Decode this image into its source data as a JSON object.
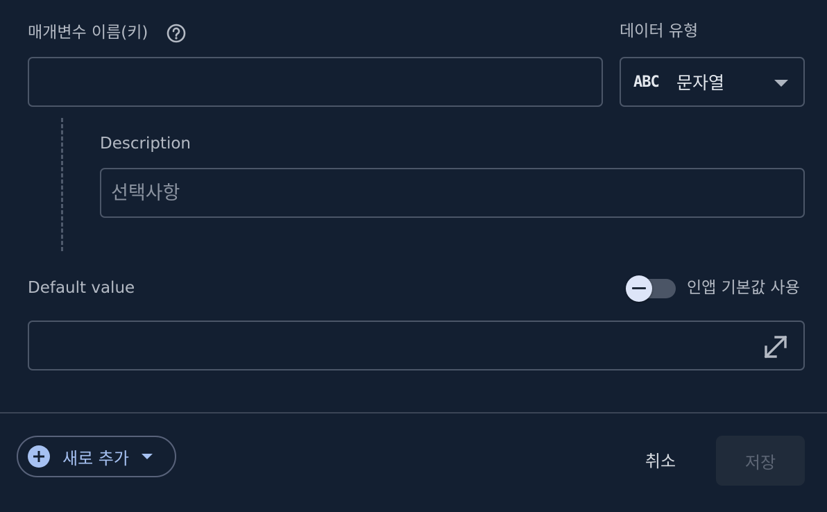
{
  "param_name": {
    "label": "매개변수 이름(키)",
    "value": ""
  },
  "data_type": {
    "label": "데이터 유형",
    "icon": "abc-icon",
    "icon_text": "ABC",
    "value": "문자열"
  },
  "description": {
    "label": "Description",
    "value": "",
    "placeholder": "선택사항"
  },
  "default_value": {
    "label": "Default value",
    "value": ""
  },
  "in_app_default": {
    "label": "인앱 기본값 사용",
    "enabled": false
  },
  "footer": {
    "add_label": "새로 추가",
    "cancel_label": "취소",
    "save_label": "저장"
  },
  "colors": {
    "background": "#131f31",
    "accent": "#a6c1f2",
    "border": "#4b5668"
  }
}
